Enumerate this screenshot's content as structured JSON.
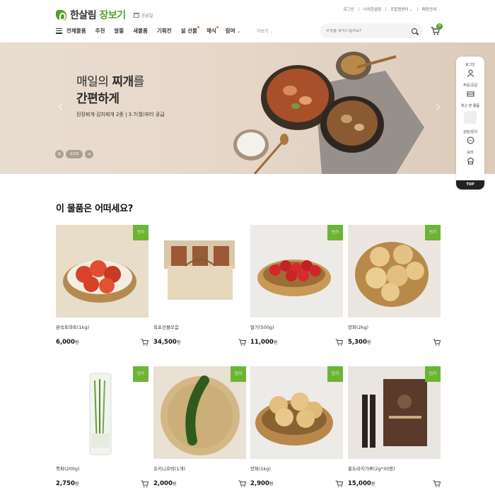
{
  "header": {
    "logo_main": "한살림",
    "logo_accent": "장보기",
    "supply_label": "공급일",
    "util_links": [
      "로그인",
      "나의한살림",
      "조합원센터",
      "매장안내"
    ],
    "util_chevron": "⌄",
    "nav_items": [
      "전체물품",
      "추천",
      "알뜰",
      "새물품",
      "기획전",
      "설 선물",
      "채식",
      "참여"
    ],
    "nav_more": "더보기",
    "search_placeholder": "무엇을 찾아드릴까요?",
    "cart_count": "0"
  },
  "banner": {
    "title_line1_pre": "매일의 ",
    "title_line1_bold": "찌개",
    "title_line1_post": "를",
    "title_line2": "간편하게",
    "subtitle": "된장찌개·김치찌개 2종 | 3.7(월)부터 공급",
    "pager": "1/10",
    "pause_symbol": "II",
    "plus_symbol": "+"
  },
  "quick_menu": {
    "items": [
      "로그인",
      "주문/공급",
      "최근 본 물품",
      "상담/문의",
      "요리"
    ],
    "top_label": "TOP"
  },
  "section": {
    "title": "이 물품은 어떠세요?",
    "badge_label": "인기",
    "currency": "원",
    "products": [
      {
        "name": "완숙토마토(1kg)",
        "price": "6,000",
        "badge": true
      },
      {
        "name": "육포선물모음",
        "price": "34,500",
        "badge": false
      },
      {
        "name": "딸기(500g)",
        "price": "11,000",
        "badge": true
      },
      {
        "name": "양파(2kg)",
        "price": "5,300",
        "badge": true
      },
      {
        "name": "쪽파(200g)",
        "price": "2,750",
        "badge": true
      },
      {
        "name": "쥬키니호박(1개)",
        "price": "2,000",
        "badge": true
      },
      {
        "name": "양파(1kg)",
        "price": "2,900",
        "badge": true
      },
      {
        "name": "홍도라지가루(2g*30봉)",
        "price": "15,000",
        "badge": true
      }
    ]
  }
}
